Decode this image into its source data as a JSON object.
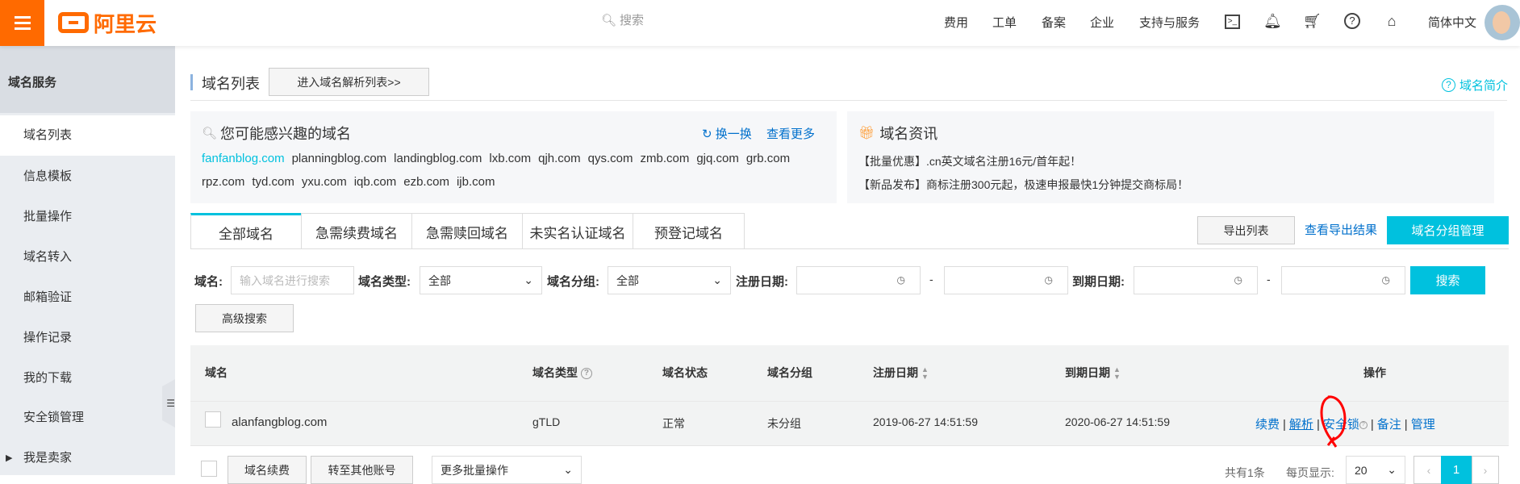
{
  "header": {
    "logo": "阿里云",
    "search_placeholder": "搜索",
    "nav": [
      "费用",
      "工单",
      "备案",
      "企业",
      "支持与服务"
    ],
    "icons": [
      "terminal-icon",
      "bell-icon",
      "cart-icon",
      "help-icon",
      "home-icon"
    ],
    "language": "简体中文"
  },
  "sidebar": {
    "title": "域名服务",
    "items": [
      "域名列表",
      "信息模板",
      "批量操作",
      "域名转入",
      "邮箱验证",
      "操作记录",
      "我的下载",
      "安全锁管理",
      "我是卖家"
    ]
  },
  "page": {
    "title": "域名列表",
    "dns_button": "进入域名解析列表>>",
    "intro_link": "域名简介"
  },
  "suggest": {
    "title": "您可能感兴趣的域名",
    "refresh": "换一换",
    "more": "查看更多",
    "domains": [
      "fanfanblog.com",
      "planningblog.com",
      "landingblog.com",
      "lxb.com",
      "qjh.com",
      "qys.com",
      "zmb.com",
      "gjq.com",
      "grb.com",
      "rpz.com",
      "tyd.com",
      "yxu.com",
      "iqb.com",
      "ezb.com",
      "ijb.com"
    ]
  },
  "news": {
    "title": "域名资讯",
    "items": [
      "【批量优惠】.cn英文域名注册16元/首年起！",
      "【新品发布】商标注册300元起，极速申报最快1分钟提交商标局！"
    ]
  },
  "tabs": [
    "全部域名",
    "急需续费域名",
    "急需赎回域名",
    "未实名认证域名",
    "预登记域名"
  ],
  "toolbar": {
    "export": "导出列表",
    "view_export": "查看导出结果",
    "group_manage": "域名分组管理"
  },
  "filters": {
    "domain_label": "域名:",
    "domain_placeholder": "输入域名进行搜索",
    "type_label": "域名类型:",
    "type_value": "全部",
    "group_label": "域名分组:",
    "group_value": "全部",
    "reg_label": "注册日期:",
    "exp_label": "到期日期:",
    "dash": "-",
    "search": "搜索",
    "advanced": "高级搜索"
  },
  "table": {
    "headers": [
      "域名",
      "域名类型",
      "域名状态",
      "域名分组",
      "注册日期",
      "到期日期",
      "操作"
    ],
    "rows": [
      {
        "domain": "alanfangblog.com",
        "type": "gTLD",
        "status": "正常",
        "group": "未分组",
        "reg": "2019-06-27 14:51:59",
        "exp": "2020-06-27 14:51:59",
        "actions": [
          "续费",
          "解析",
          "安全锁",
          "备注",
          "管理"
        ]
      }
    ]
  },
  "footer": {
    "renew": "域名续费",
    "transfer": "转至其他账号",
    "more_ops": "更多批量操作",
    "total": "共有1条",
    "per_page_label": "每页显示:",
    "per_page": "20",
    "prev": "‹",
    "page": "1",
    "next": "›"
  }
}
